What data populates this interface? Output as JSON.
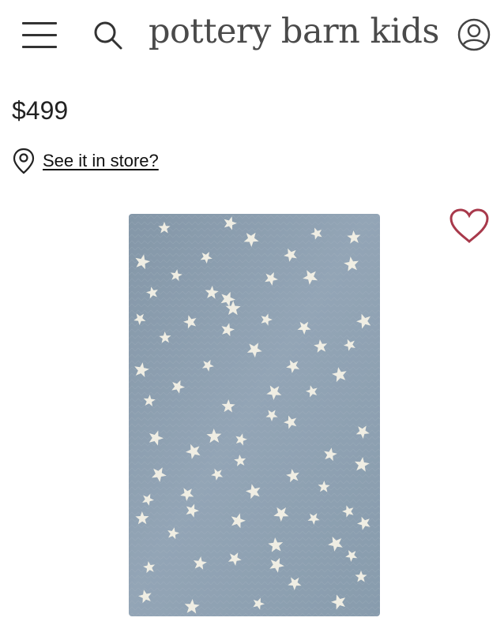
{
  "header": {
    "brand": "pottery barn kids",
    "icons": {
      "menu": "menu-icon",
      "search": "search-icon",
      "account": "account-icon"
    }
  },
  "product": {
    "price": "$499",
    "store_link": "See it in store?",
    "location_icon": "location-pin-icon",
    "favorite_icon": "heart-icon",
    "image_description_icon": "star-rug-image"
  },
  "colors": {
    "text": "#222222",
    "brand_text": "#4a4a4a",
    "heart": "#a8394b",
    "rug_base": "#8da0b1",
    "rug_star": "#f4f1e6"
  }
}
